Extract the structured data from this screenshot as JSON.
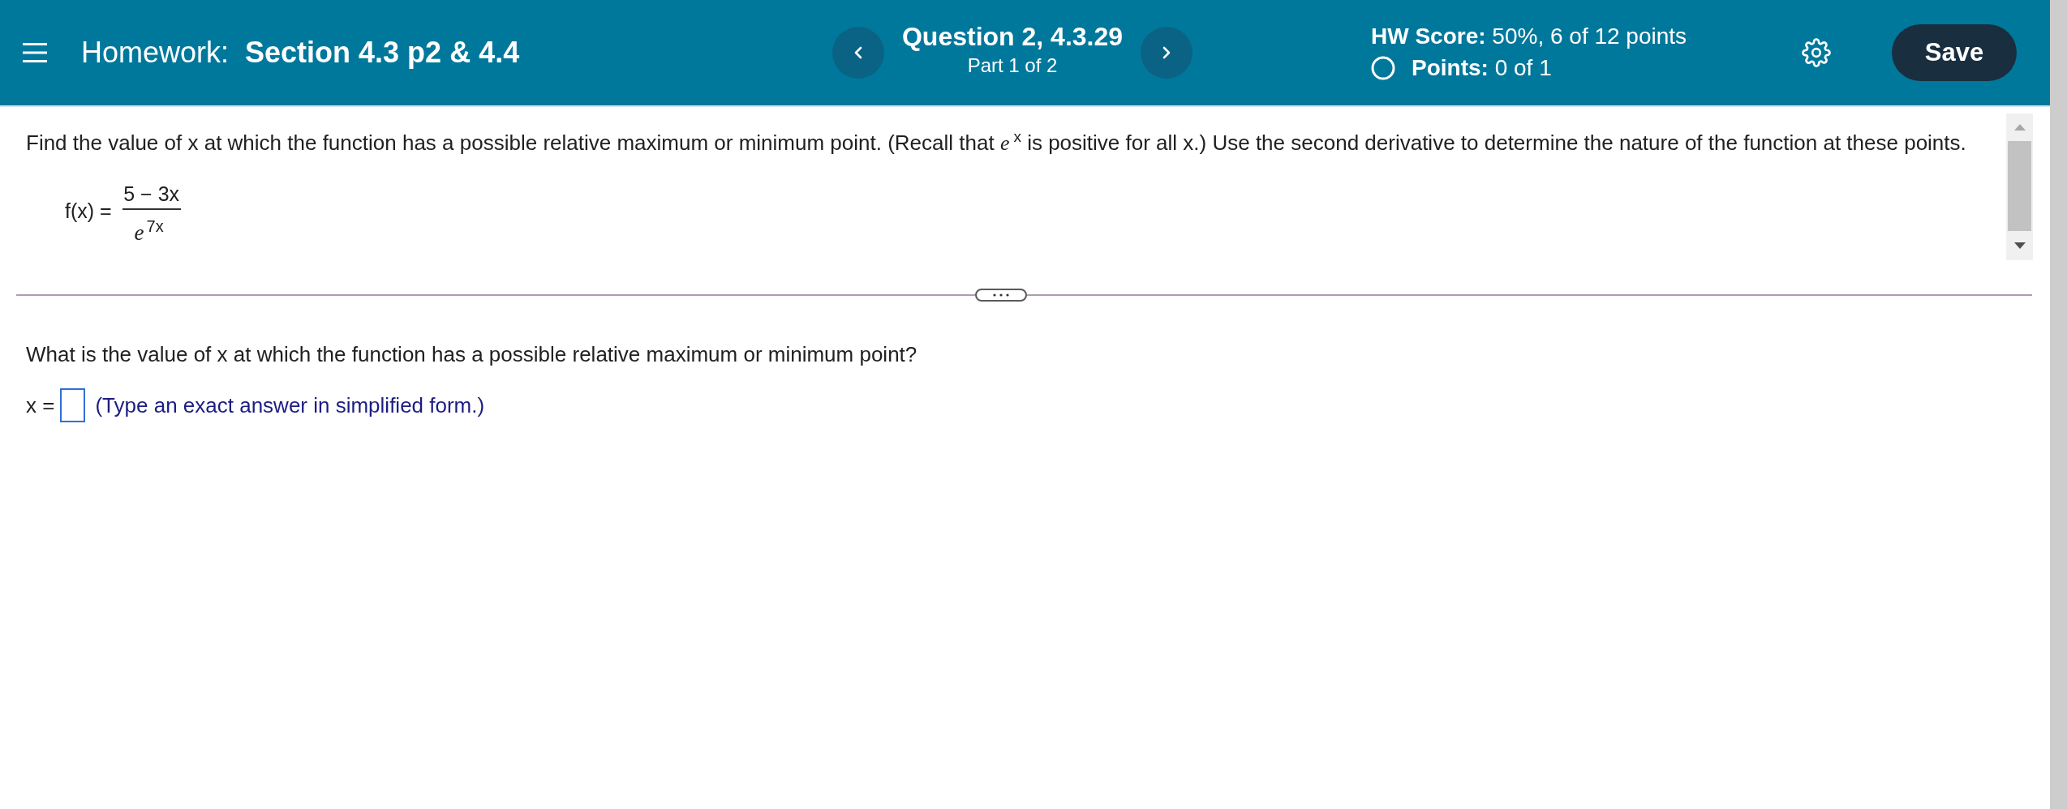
{
  "header": {
    "title_prefix": "Homework:",
    "title": "Section 4.3 p2 & 4.4",
    "question_title": "Question 2, 4.3.29",
    "question_part": "Part 1 of 2",
    "score": "**HW Score:** 50%, 6 of 12 points",
    "points": "**Points:** 0 of 1",
    "save_label": "Save"
  },
  "problem": {
    "statement": "Find the value of x at which the function has a possible relative maximum or minimum point. (Recall that *e*$^{x}$ is positive for all x.) Use the second derivative to determine the nature of the function at these points.",
    "function": {
      "name": "f(x) =",
      "numerator": "5 − 3x",
      "denominator": "*e*$^{7x}$"
    }
  },
  "part": {
    "prompt": "What is the value of x at which the function has a possible relative maximum or minimum point?",
    "answer_label": "x =",
    "hint": "(Type an exact answer in simplified form.)"
  }
}
